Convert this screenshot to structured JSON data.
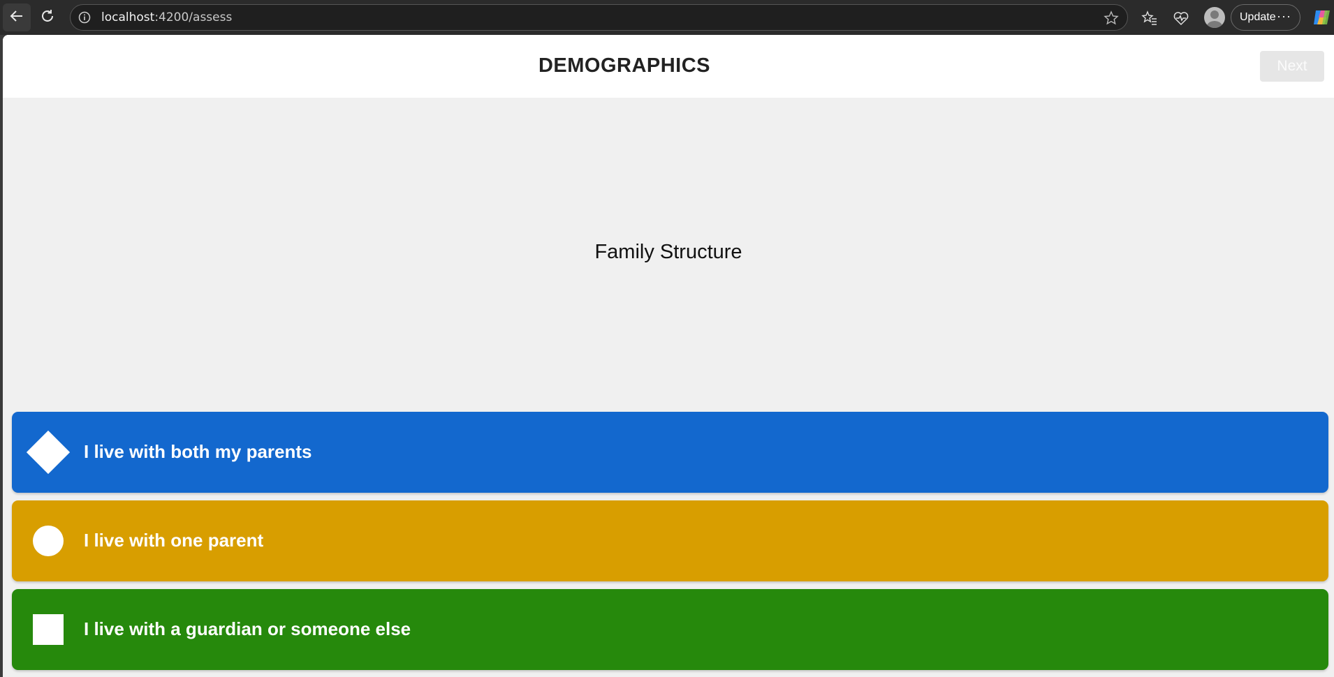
{
  "browser": {
    "url_host": "localhost",
    "url_rest": ":4200/assess",
    "update_label": "Update",
    "more_label": "···"
  },
  "page": {
    "title": "DEMOGRAPHICS",
    "next_label": "Next",
    "question": "Family Structure"
  },
  "answers": [
    {
      "label": "I live with both my parents",
      "shape": "diamond-icon",
      "color": "#1368ce"
    },
    {
      "label": "I live with one parent",
      "shape": "circle-icon",
      "color": "#d89e00"
    },
    {
      "label": "I live with a guardian or someone else",
      "shape": "square-icon",
      "color": "#26890c"
    }
  ],
  "colors": {
    "page_background": "#f0f0f0",
    "header_background": "#ffffff",
    "next_disabled": "#e6e6e6"
  }
}
